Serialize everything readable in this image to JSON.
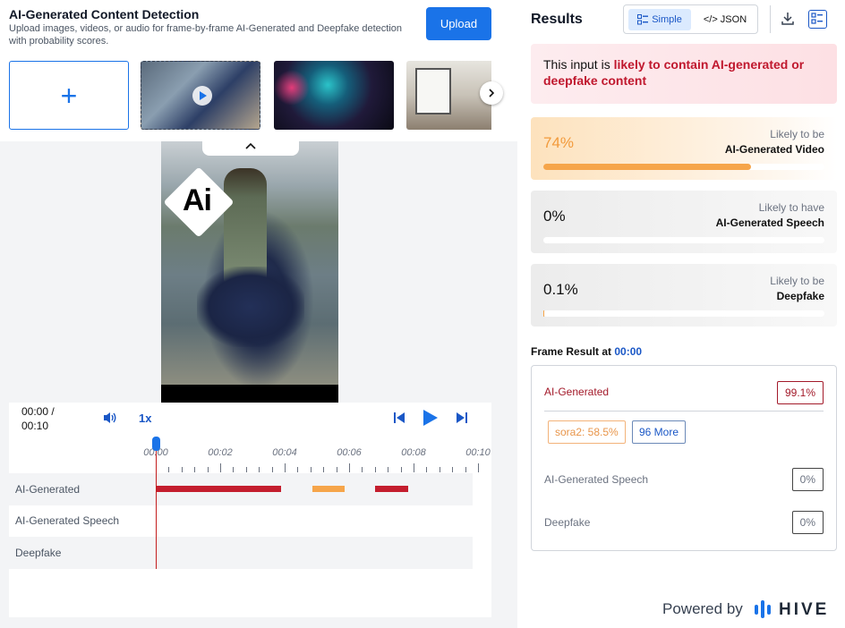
{
  "app": {
    "title": "AI-Generated Content Detection",
    "subtitle": "Upload images, videos, or audio for frame-by-frame AI-Generated and Deepfake detection with probability scores.",
    "upload_label": "Upload"
  },
  "player": {
    "current_time": "00:00 /",
    "duration": "00:10",
    "speed": "1x",
    "overlay_logo_text": "Ai",
    "ticks": [
      "00:00",
      "00:02",
      "00:04",
      "00:06",
      "00:08",
      "00:10"
    ],
    "tracks": [
      {
        "label": "AI-Generated"
      },
      {
        "label": "AI-Generated Speech"
      },
      {
        "label": "Deepfake"
      }
    ]
  },
  "results": {
    "title": "Results",
    "toggle_simple": "Simple",
    "toggle_json": "</> JSON",
    "verdict_prefix": "This input is ",
    "verdict_highlight": "likely to contain AI-generated or deepfake content",
    "cards": [
      {
        "pct": "74%",
        "line1": "Likely to be",
        "line2": "AI-Generated Video",
        "fill": 0.74,
        "color": "#f6a54a"
      },
      {
        "pct": "0%",
        "line1": "Likely to have",
        "line2": "AI-Generated Speech",
        "fill": 0.0,
        "color": "#f6a54a"
      },
      {
        "pct": "0.1%",
        "line1": "Likely to be",
        "line2": "Deepfake",
        "fill": 0.001,
        "color": "#f6a54a"
      }
    ],
    "frame_label": "Frame Result at ",
    "frame_time": "00:00",
    "frame_rows": [
      {
        "label": "AI-Generated",
        "value": "99.1%"
      },
      {
        "label": "AI-Generated Speech",
        "value": "0%"
      },
      {
        "label": "Deepfake",
        "value": "0%"
      }
    ],
    "chips": [
      {
        "label": "sora2: 58.5%"
      },
      {
        "label": "96 More"
      }
    ],
    "powered_by": "Powered by",
    "brand": "HIVE"
  },
  "colors": {
    "accent": "#1a73e8",
    "ai_generated_red": "#c41e2e",
    "orange": "#f6a54a"
  }
}
